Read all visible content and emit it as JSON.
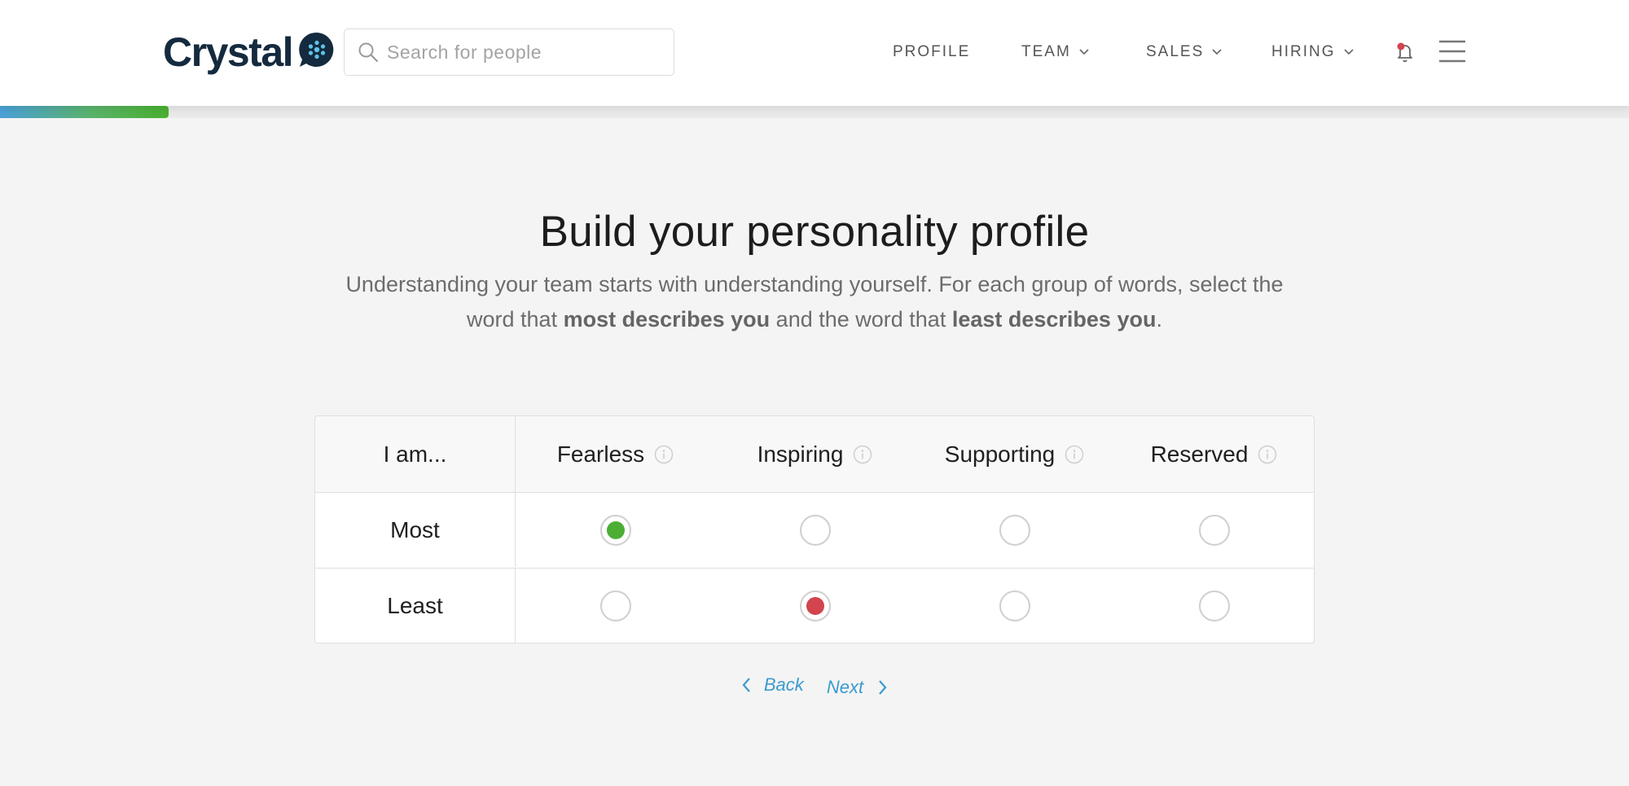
{
  "brand": {
    "name": "Crystal",
    "colors": {
      "navy": "#142a3e",
      "accent_blue": "#3a9bcf",
      "green": "#4cae35",
      "red": "#d2444e"
    }
  },
  "search": {
    "placeholder": "Search for people",
    "value": ""
  },
  "nav": {
    "profile": "PROFILE",
    "team": "TEAM",
    "sales": "SALES",
    "hiring": "HIRING"
  },
  "icons": {
    "logo": "crystal-logo-mark",
    "search": "search-icon",
    "bell": "bell-icon",
    "menu": "hamburger-menu-icon",
    "info": "info-icon",
    "chevron": "chevron-down-icon"
  },
  "progress": {
    "fraction": 0.1
  },
  "page": {
    "title": "Build your personality profile",
    "subtitle_part1": "Understanding your team starts with understanding yourself. For each group of words, select the word that ",
    "subtitle_bold1": "most describes you",
    "subtitle_part2": " and the word that ",
    "subtitle_bold2": "least describes you",
    "subtitle_part3": "."
  },
  "table": {
    "header_label": "I am...",
    "words": [
      "Fearless",
      "Inspiring",
      "Supporting",
      "Reserved"
    ],
    "rows": [
      {
        "label": "Most",
        "selected_index": 0
      },
      {
        "label": "Least",
        "selected_index": 1
      }
    ]
  },
  "pager": {
    "back": "Back",
    "next": "Next"
  }
}
